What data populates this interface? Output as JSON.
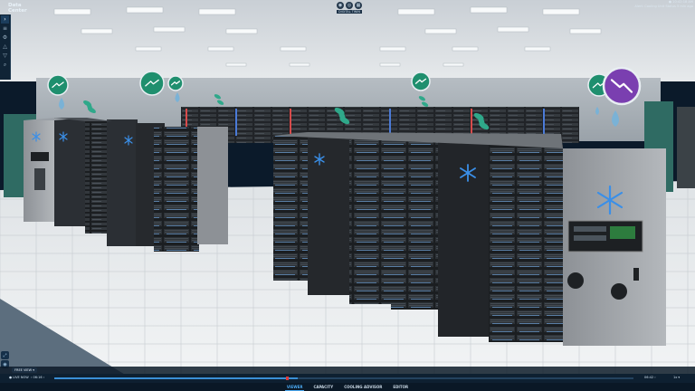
{
  "app": {
    "logo_line1": "Data",
    "logo_line2": "Center"
  },
  "sidebar": {
    "items": [
      {
        "icon": "chevron-right-icon",
        "glyph": "›"
      },
      {
        "icon": "layers-icon",
        "glyph": "≡"
      },
      {
        "icon": "gear-icon",
        "glyph": "⚙"
      },
      {
        "icon": "alert-icon",
        "glyph": "△"
      },
      {
        "icon": "filter-icon",
        "glyph": "▽"
      },
      {
        "icon": "search-icon",
        "glyph": "⌕"
      }
    ]
  },
  "topbar": {
    "icons": [
      {
        "icon": "camera-icon",
        "glyph": "◉"
      },
      {
        "icon": "target-icon",
        "glyph": "◎"
      },
      {
        "icon": "grid-icon",
        "glyph": "▦"
      }
    ],
    "view_label": "DIGITAL TWIN"
  },
  "status": {
    "line1": "● 10:42:18 AM",
    "line2": "Alert: Cooling Unit Status 5 min ago"
  },
  "left_controls": [
    {
      "icon": "fullscreen-icon",
      "glyph": "⤢"
    },
    {
      "icon": "eye-icon",
      "glyph": "◉"
    }
  ],
  "mode_chip": "FREE VIEW ▾",
  "timeline": {
    "live": "● LIVE NOW",
    "start": "‹ 06:16 ›",
    "end": "06:42 ›",
    "rate": "1x ▾",
    "progress": 0.42,
    "handle": 0.4
  },
  "tabs": [
    {
      "label": "VIEWER",
      "active": true
    },
    {
      "label": "CAPACITY",
      "active": false
    },
    {
      "label": "COOLING ADVISOR",
      "active": false
    },
    {
      "label": "EDITOR",
      "active": false
    }
  ],
  "markers": [
    {
      "type": "trend-up",
      "color": "#1f8f6e"
    },
    {
      "type": "trend-up",
      "color": "#1f8f6e"
    },
    {
      "type": "trend-up",
      "color": "#1f8f6e"
    },
    {
      "type": "trend-up",
      "color": "#1f8f6e"
    },
    {
      "type": "trend-up",
      "color": "#1f8f6e"
    },
    {
      "type": "trend-down",
      "color": "#7a3fb0"
    }
  ],
  "colors": {
    "accent": "#4aa8f0",
    "snowflake": "#3a8fe8",
    "fan": "#2fa88a",
    "alert": "#7a3fb0"
  }
}
